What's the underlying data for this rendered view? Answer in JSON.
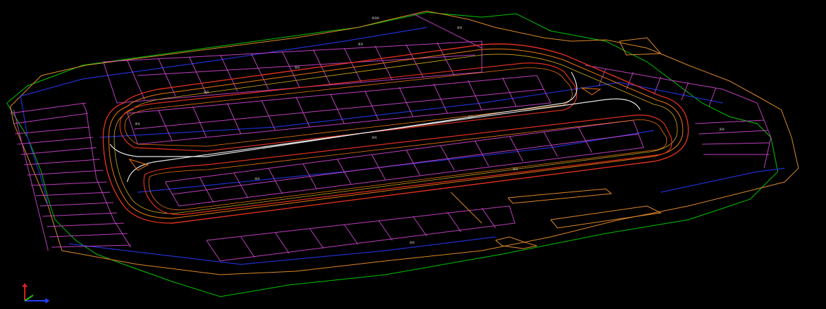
{
  "viewport": {
    "background": "#000000",
    "colors": {
      "boundary_outer": "#00c800",
      "boundary_orange": "#e08a2a",
      "parcel_magenta": "#c040c0",
      "road_red": "#e03020",
      "road_orange": "#f07a10",
      "road_yellow": "#d8b020",
      "centerline_white": "#e8e8e8",
      "easement_blue": "#2030d0",
      "label_gray": "#c8c8c8"
    },
    "labels": [
      "ᴙᴙᴙ",
      "ᴙᴙ",
      "ᴙᴙ",
      "ᴙᴙ",
      "ᴙᴙ",
      "ᴙᴙ",
      "ᴙᴙ",
      "ᴙᴙ",
      "ᴙᴙ",
      "ᴙᴙ",
      "ᴙᴙ",
      "ᴙᴙ"
    ],
    "view": "isometric 3D parcel layout"
  },
  "ucs": {
    "icon": "ucs-axis-icon",
    "x_color": "#2040ff",
    "y_color": "#20c020",
    "z_color": "#e02020"
  }
}
